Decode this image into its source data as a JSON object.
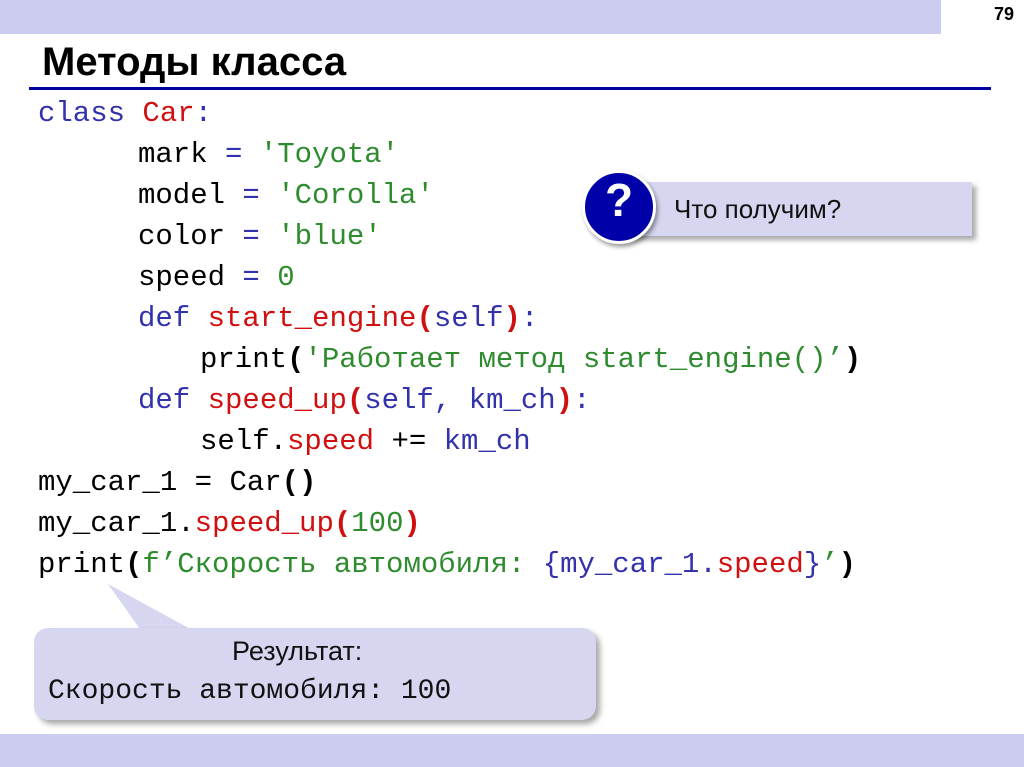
{
  "slide": {
    "page_number": "79",
    "title": "Методы класса"
  },
  "code": {
    "l1": {
      "kw": "class",
      "name": "Car",
      "colon": ":"
    },
    "l2": {
      "var": "mark",
      "eq": "=",
      "val": "'Toyota'"
    },
    "l3": {
      "var": "model",
      "eq": "=",
      "val": "'Corolla'"
    },
    "l4": {
      "var": "color",
      "eq": "=",
      "val": "'blue'"
    },
    "l5": {
      "var": "speed",
      "eq": "=",
      "val": "0"
    },
    "l6": {
      "kw": "def",
      "name": "start_engine",
      "paren_open": "(",
      "arg": "self",
      "paren_close": ")",
      "colon": ":"
    },
    "l7": {
      "fn": "print",
      "paren_open": "(",
      "str": "'Работает метод start_engine()’",
      "paren_close": ")"
    },
    "l8": {
      "kw": "def",
      "name": "speed_up",
      "paren_open": "(",
      "arg": "self, km_ch",
      "paren_close": ")",
      "colon": ":"
    },
    "l9": {
      "obj": "self.",
      "attr": "speed",
      "op": "+=",
      "arg": "km_ch"
    },
    "l10": {
      "var": "my_car_1",
      "eq": "=",
      "call": "Car",
      "parens": "()"
    },
    "l11": {
      "obj": "my_car_1.",
      "method": "speed_up",
      "paren_open": "(",
      "num": "100",
      "paren_close": ")"
    },
    "l12": {
      "fn": "print",
      "paren_open": "(",
      "fstr": "f’Скорость автомобиля: ",
      "brace_open": "{",
      "expr_obj": "my_car_1.",
      "expr_attr": "speed",
      "brace_close": "}",
      "fstr_end": "’",
      "paren_close": ")"
    }
  },
  "question": {
    "icon": "question-mark-icon",
    "mark": "?",
    "text": "Что получим?"
  },
  "result": {
    "label": "Результат:",
    "value": "Скорость автомобиля: 100"
  },
  "colors": {
    "band": "#ccccf0",
    "title_rule": "#0000a0",
    "keyword": "#3232ac",
    "name": "#d01010",
    "string": "#2e8b2e",
    "bubble": "#d6d6f0",
    "question_circle": "#0000a8"
  }
}
